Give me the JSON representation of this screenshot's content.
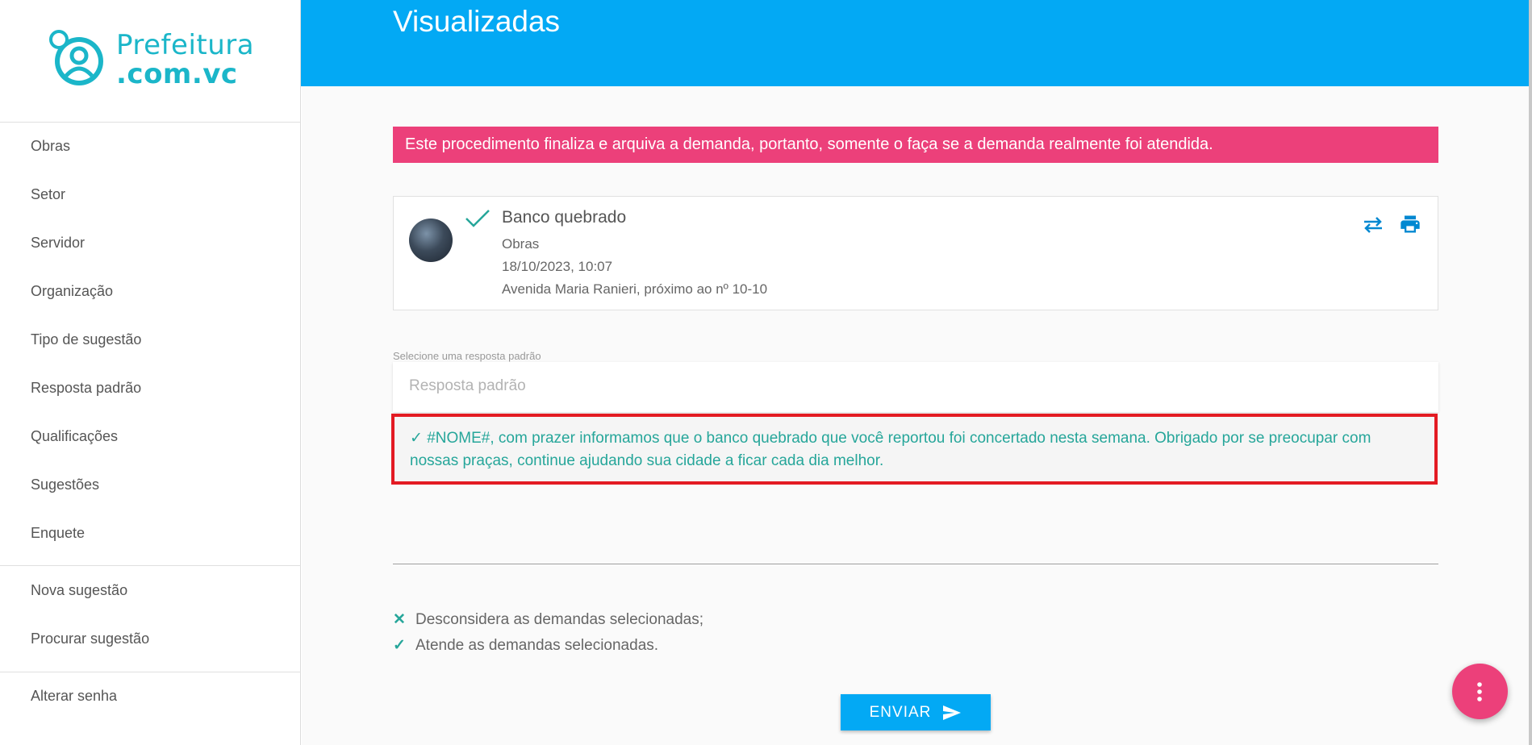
{
  "brand": {
    "line1": "Prefeitura",
    "line2": ".com.vc"
  },
  "sidebar": {
    "items": [
      {
        "label": "Obras"
      },
      {
        "label": "Setor"
      },
      {
        "label": "Servidor"
      },
      {
        "label": "Organização"
      },
      {
        "label": "Tipo de sugestão"
      },
      {
        "label": "Resposta padrão"
      },
      {
        "label": "Qualificações"
      },
      {
        "label": "Sugestões"
      },
      {
        "label": "Enquete"
      },
      {
        "label": "Nova sugestão"
      },
      {
        "label": "Procurar sugestão"
      },
      {
        "label": "Alterar senha"
      }
    ]
  },
  "header": {
    "title": "Visualizadas"
  },
  "alert": {
    "text": "Este procedimento finaliza e arquiva a demanda, portanto, somente o faça se a demanda realmente foi atendida."
  },
  "demand": {
    "title": "Banco quebrado",
    "category": "Obras",
    "datetime": "18/10/2023, 10:07",
    "address": "Avenida Maria Ranieri, próximo ao nº 10-10",
    "status_icon": "check-icon",
    "actions": [
      "swap-icon",
      "print-icon"
    ]
  },
  "response": {
    "label": "Selecione uma resposta padrão",
    "placeholder": "Resposta padrão",
    "option_text": "✓ #NOME#, com prazer informamos que o banco quebrado que você reportou foi concertado nesta semana. Obrigado por se preocupar com nossas praças, continue ajudando sua cidade a ficar cada dia melhor."
  },
  "legend": {
    "discard": {
      "icon": "✕",
      "text": "Desconsidera as demandas selecionadas;"
    },
    "attend": {
      "icon": "✓",
      "text": "Atende as demandas selecionadas."
    }
  },
  "send_button": {
    "label": "ENVIAR"
  },
  "colors": {
    "header": "#03a9f4",
    "alert": "#ec407a",
    "teal": "#26a69a",
    "brand": "#1bb6c9",
    "highlight_border": "#e31b23"
  }
}
